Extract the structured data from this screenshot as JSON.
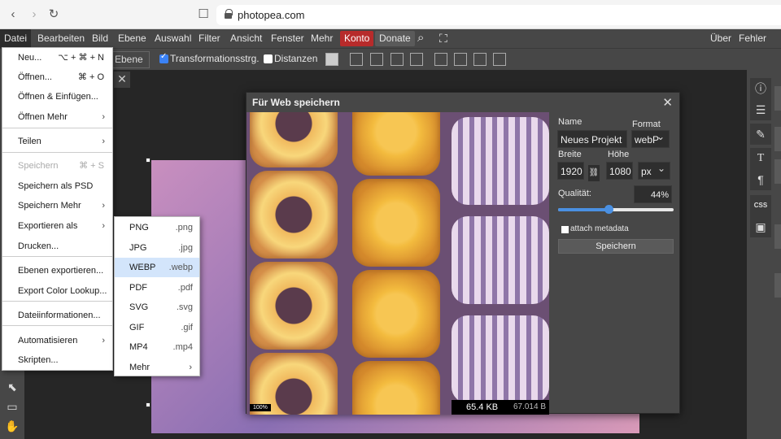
{
  "browser": {
    "url": "photopea.com"
  },
  "menubar": {
    "items": [
      "Datei",
      "Bearbeiten",
      "Bild",
      "Ebene",
      "Auswahl",
      "Filter",
      "Ansicht",
      "Fenster",
      "Mehr"
    ],
    "konto": "Konto",
    "donate": "Donate",
    "right": [
      "Über",
      "Fehler melden"
    ]
  },
  "optbar": {
    "select_value": "Ebene",
    "transform_label": "Transformationsstrg.",
    "transform_checked": true,
    "distances_label": "Distanzen",
    "distances_checked": false
  },
  "file_menu": {
    "items": [
      {
        "label": "Neu...",
        "shortcut": "⌥ + ⌘ + N"
      },
      {
        "label": "Öffnen...",
        "shortcut": "⌘ + O"
      },
      {
        "label": "Öffnen & Einfügen..."
      },
      {
        "label": "Öffnen Mehr",
        "submenu": true
      },
      {
        "label": "Teilen",
        "submenu": true
      },
      {
        "label": "Speichern",
        "shortcut": "⌘ + S",
        "disabled": true
      },
      {
        "label": "Speichern als PSD"
      },
      {
        "label": "Speichern Mehr",
        "submenu": true
      },
      {
        "label": "Exportieren als",
        "submenu": true
      },
      {
        "label": "Drucken..."
      },
      {
        "label": "Ebenen exportieren..."
      },
      {
        "label": "Export Color Lookup..."
      },
      {
        "label": "Dateiinformationen..."
      },
      {
        "label": "Automatisieren",
        "submenu": true
      },
      {
        "label": "Skripten..."
      }
    ]
  },
  "export_menu": {
    "items": [
      {
        "label": "PNG",
        "ext": ".png"
      },
      {
        "label": "JPG",
        "ext": ".jpg"
      },
      {
        "label": "WEBP",
        "ext": ".webp",
        "highlighted": true
      },
      {
        "label": "PDF",
        "ext": ".pdf"
      },
      {
        "label": "SVG",
        "ext": ".svg"
      },
      {
        "label": "GIF",
        "ext": ".gif"
      },
      {
        "label": "MP4",
        "ext": ".mp4"
      },
      {
        "label": "Mehr",
        "submenu": true
      }
    ]
  },
  "dialog": {
    "title": "Für Web speichern",
    "zoom": "100%",
    "size_new": "65.4 KB",
    "size_orig": "67.014 B",
    "name_label": "Name",
    "name_value": "Neues Projekt",
    "format_label": "Format",
    "format_value": "webP",
    "width_label": "Breite",
    "width_value": "1920",
    "height_label": "Höhe",
    "height_value": "1080",
    "unit_value": "px",
    "quality_label": "Qualität:",
    "quality_value": "44%",
    "quality_fraction": 0.44,
    "metadata_label": "attach metadata",
    "metadata_checked": false,
    "save_label": "Speichern"
  },
  "colors": {
    "konto_bg": "#b72b2b",
    "accent": "#4a90e2",
    "highlight": "#d3e5fb"
  }
}
